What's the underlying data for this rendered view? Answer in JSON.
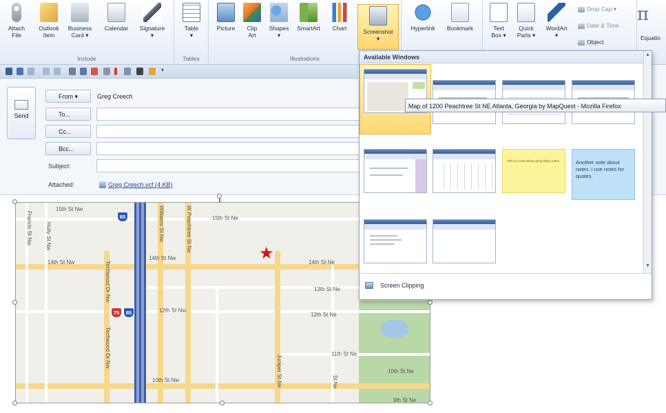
{
  "ribbon": {
    "include": {
      "name": "Include",
      "buttons": [
        {
          "label": "Attach",
          "sub": "File",
          "icon": "paperclip-icon"
        },
        {
          "label": "Outlook",
          "sub": "Item",
          "icon": "outlook-item-icon"
        },
        {
          "label": "Business",
          "sub": "Card ▾",
          "icon": "business-card-icon"
        },
        {
          "label": "Calendar",
          "sub": "",
          "icon": "calendar-icon"
        },
        {
          "label": "Signature",
          "sub": "▾",
          "icon": "signature-icon"
        }
      ]
    },
    "tables": {
      "name": "Tables",
      "label": "Table",
      "sub": "▾"
    },
    "illustrations": {
      "name": "Illustrations",
      "buttons": [
        {
          "label": "Picture",
          "sub": "",
          "icon": "picture-icon"
        },
        {
          "label": "Clip",
          "sub": "Art",
          "icon": "clip-art-icon"
        },
        {
          "label": "Shapes",
          "sub": "▾",
          "icon": "shapes-icon"
        },
        {
          "label": "SmartArt",
          "sub": "",
          "icon": "smartart-icon"
        },
        {
          "label": "Chart",
          "sub": "",
          "icon": "chart-icon"
        },
        {
          "label": "Screenshot",
          "sub": "▾",
          "icon": "screenshot-icon"
        }
      ]
    },
    "links": [
      {
        "label": "Hyperlink",
        "icon": "globe-link-icon"
      },
      {
        "label": "Bookmark",
        "icon": "bookmark-icon"
      }
    ],
    "text": [
      {
        "label": "Text",
        "sub": "Box ▾",
        "icon": "text-box-icon"
      },
      {
        "label": "Quick",
        "sub": "Parts ▾",
        "icon": "quick-parts-icon"
      },
      {
        "label": "WordArt",
        "sub": "▾",
        "icon": "wordart-icon"
      }
    ],
    "small": {
      "dropcap": "Drop Cap ▾",
      "datetime": "Date & Time",
      "object": "Object"
    },
    "equation": {
      "glyph": "π",
      "label": "Equatio"
    }
  },
  "qat": {
    "icons": [
      "save-icon",
      "undo-icon",
      "redo-icon",
      "previous-icon",
      "next-icon",
      "print-icon",
      "spelling-icon",
      "flag-icon",
      "attach-icon",
      "importance-high-icon",
      "insert-icon",
      "close-icon",
      "format-icon"
    ],
    "more": "▾"
  },
  "message": {
    "send": "Send",
    "from_btn": "From ▾",
    "from_value": "Greg Creech",
    "to_btn": "To...",
    "cc_btn": "Cc...",
    "bcc_btn": "Bcc...",
    "subject_label": "Subject:",
    "attached_label": "Attached:",
    "attachment": "Greg Creech.vcf (4 KB)"
  },
  "map": {
    "streets": {
      "s1": "15th St Nw",
      "s2": "15th St Ne",
      "s3": "14th St Nw",
      "s4": "14th St Nw",
      "s5": "14th St Ne",
      "s6": "13th St Ne",
      "s7": "12th St Nw",
      "s8": "12th St Ne",
      "s9": "11th St Ne",
      "s10": "10th St Nw",
      "s11": "10th St Ne",
      "s12": "9th St Ne"
    },
    "vstreets": {
      "v1": "Francis St Nw",
      "v2": "Holly St Nw",
      "v3": "Williams St Nw",
      "v4": "W Peachtree St Ne",
      "v5": "Techwood Dr Nw",
      "v6": "Techwood Dr Nw",
      "v7": "Juniper St Ne",
      "v8": "St Ne"
    },
    "shields": {
      "i85a": "85",
      "i75": "75",
      "i85b": "85"
    }
  },
  "gallery": {
    "header": "Available Windows",
    "tooltip": "Map of 1200 Peachtree St NE Atlanta, Georgia by MapQuest - Mozilla Firefox",
    "note1": "This is a note about using sticky notes",
    "note2": "Another note about notes. I use notes for quotes.",
    "footer": "Screen Clipping",
    "scroll_up": "▲",
    "scroll_down": "▼"
  }
}
